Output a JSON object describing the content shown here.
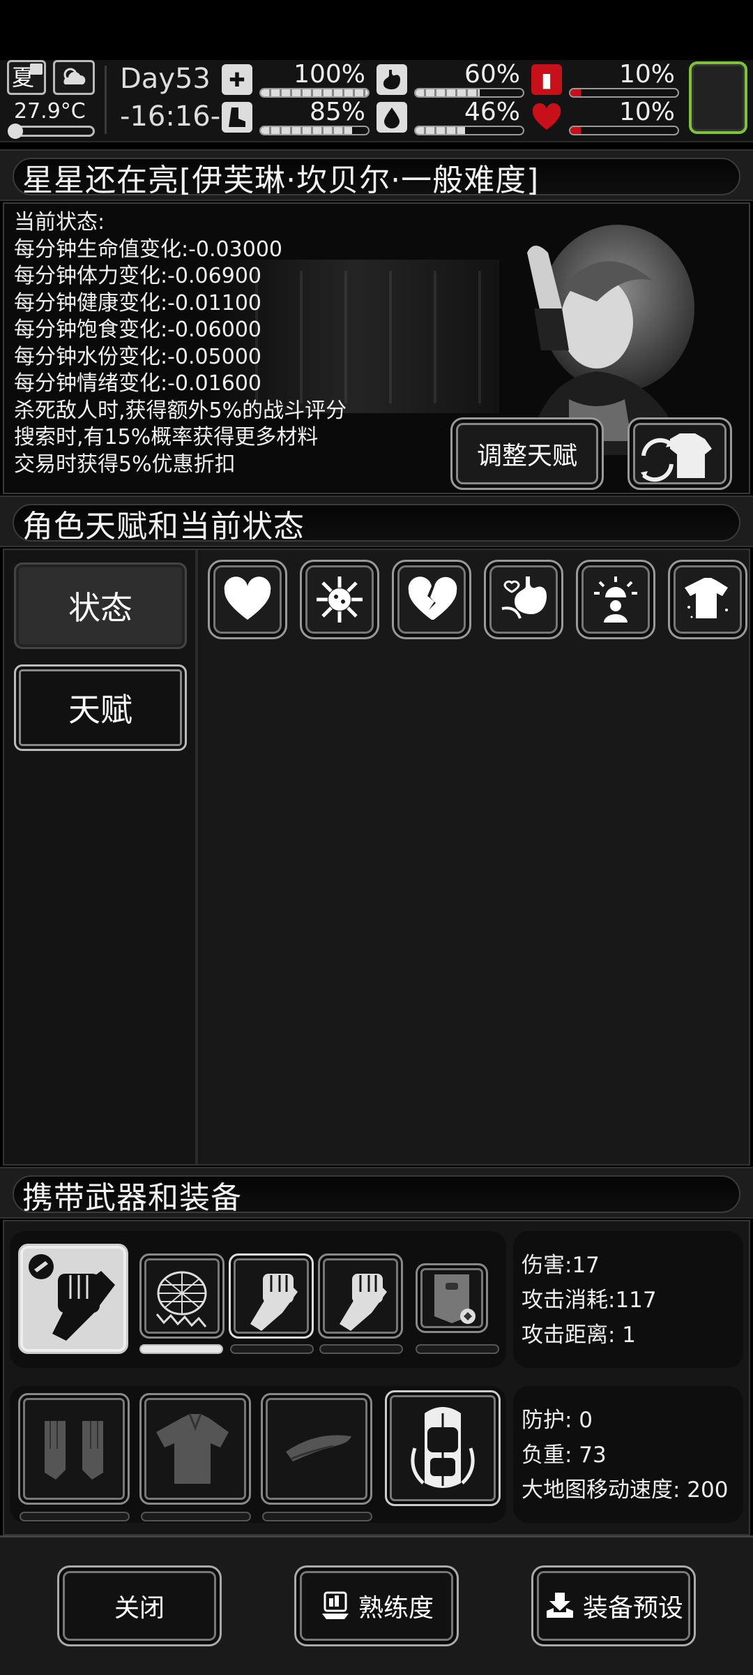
{
  "topbar": {
    "season": "夏",
    "temperature": "27.9°C",
    "day": "Day53",
    "time": "-16:16-",
    "stats": [
      {
        "name": "health",
        "percent": "100%",
        "fill": 1.0,
        "icon": "medkit-icon",
        "color": "#dddddd"
      },
      {
        "name": "hunger",
        "percent": "60%",
        "fill": 0.6,
        "icon": "stomach-icon",
        "color": "#dddddd"
      },
      {
        "name": "warmth",
        "percent": "10%",
        "fill": 0.1,
        "icon": "thermos-icon",
        "color": "#c8101a"
      },
      {
        "name": "stamina",
        "percent": "85%",
        "fill": 0.85,
        "icon": "boot-icon",
        "color": "#dddddd"
      },
      {
        "name": "thirst",
        "percent": "46%",
        "fill": 0.46,
        "icon": "water-drop-icon",
        "color": "#dddddd"
      },
      {
        "name": "mood",
        "percent": "10%",
        "fill": 0.1,
        "icon": "heart-icon",
        "color": "#c8101a"
      }
    ]
  },
  "header1": {
    "title": "星星还在亮[伊芙琳·坎贝尔·一般难度]"
  },
  "status": {
    "lines": [
      "当前状态:",
      "每分钟生命值变化:-0.03000",
      "每分钟体力变化:-0.06900",
      "每分钟健康变化:-0.01100",
      "每分钟饱食变化:-0.06000",
      "每分钟水份变化:-0.05000",
      "每分钟情绪变化:-0.01600",
      "杀死敌人时,获得额外5%的战斗评分",
      "搜索时,有15%概率获得更多材料",
      "交易时获得5%优惠折扣"
    ],
    "adjust_button": "调整天赋"
  },
  "header2": {
    "title": "角色天赋和当前状态"
  },
  "tabs": {
    "state": "状态",
    "talent": "天赋"
  },
  "header3": {
    "title": "携带武器和装备"
  },
  "weapon_info": {
    "damage": "伤害:17",
    "cost": "攻击消耗:117",
    "range": "攻击距离: 1"
  },
  "armor_info": {
    "defense": "防护: 0",
    "load": "负重: 73",
    "speed": "大地图移动速度: 200"
  },
  "buttons": {
    "close": "关闭",
    "proficiency": "熟练度",
    "preset": "装备预设"
  }
}
